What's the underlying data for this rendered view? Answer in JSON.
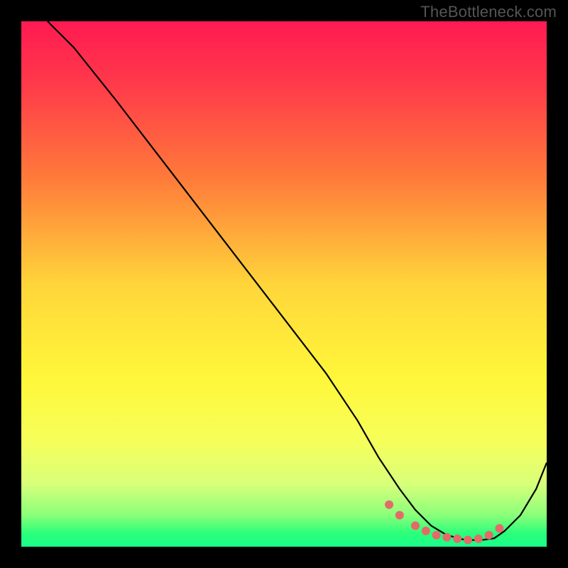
{
  "watermark": "TheBottleneck.com",
  "chart_data": {
    "type": "line",
    "title": "",
    "xlabel": "",
    "ylabel": "",
    "xlim": [
      0,
      100
    ],
    "ylim": [
      0,
      100
    ],
    "series": [
      {
        "name": "curve",
        "color": "#000000",
        "x": [
          5,
          10,
          18,
          28,
          38,
          48,
          58,
          64,
          68,
          72,
          75,
          78,
          81,
          84,
          87,
          90,
          92,
          95,
          98,
          100
        ],
        "y": [
          100,
          95,
          85,
          72,
          59,
          46,
          33,
          24,
          17,
          11,
          7,
          4,
          2.2,
          1.4,
          1.2,
          1.6,
          3,
          6,
          11,
          16
        ]
      }
    ],
    "markers": [
      {
        "x": 70,
        "y": 8
      },
      {
        "x": 72,
        "y": 6
      },
      {
        "x": 75,
        "y": 4
      },
      {
        "x": 77,
        "y": 3
      },
      {
        "x": 79,
        "y": 2.2
      },
      {
        "x": 81,
        "y": 1.8
      },
      {
        "x": 83,
        "y": 1.5
      },
      {
        "x": 85,
        "y": 1.3
      },
      {
        "x": 87,
        "y": 1.5
      },
      {
        "x": 89,
        "y": 2.2
      },
      {
        "x": 91,
        "y": 3.5
      }
    ],
    "gradient": {
      "type": "vertical",
      "stops": [
        {
          "offset": 0,
          "color": "#ff1a52"
        },
        {
          "offset": 0.12,
          "color": "#ff3a4a"
        },
        {
          "offset": 0.3,
          "color": "#ff7b3a"
        },
        {
          "offset": 0.5,
          "color": "#ffd53a"
        },
        {
          "offset": 0.68,
          "color": "#fff73a"
        },
        {
          "offset": 0.8,
          "color": "#f6ff5a"
        },
        {
          "offset": 0.88,
          "color": "#d8ff7a"
        },
        {
          "offset": 0.94,
          "color": "#8aff7a"
        },
        {
          "offset": 0.975,
          "color": "#2aff7a"
        },
        {
          "offset": 1.0,
          "color": "#1aff8a"
        }
      ]
    },
    "marker_color": "#e46a6a"
  }
}
